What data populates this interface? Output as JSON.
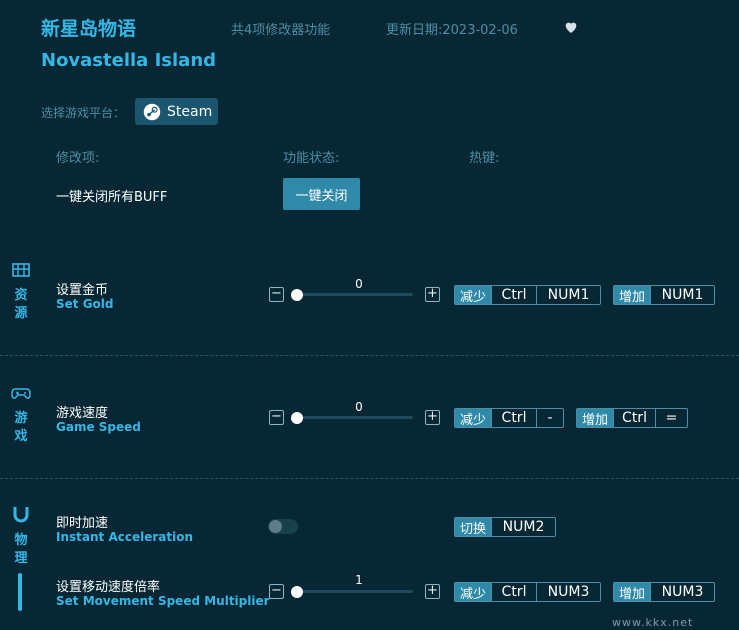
{
  "header": {
    "title_cn": "新星岛物语",
    "title_en": "Novastella Island",
    "feature_count": "共4项修改器功能",
    "update_date": "更新日期:2023-02-06",
    "favorite_icon": "heart-icon"
  },
  "platform": {
    "label": "选择游戏平台：",
    "button": "Steam",
    "icon": "steam-icon"
  },
  "columns": {
    "item": "修改项:",
    "status": "功能状态:",
    "hotkey": "热键:"
  },
  "close_all": {
    "label": "一键关闭所有BUFF",
    "button": "一键关闭"
  },
  "sections": {
    "resources": {
      "label": [
        "资",
        "源"
      ],
      "icon": "chest-icon"
    },
    "game": {
      "label": [
        "游",
        "戏"
      ],
      "icon": "gamepad-icon"
    },
    "physics": {
      "label": [
        "物",
        "理"
      ],
      "icon": "magnet-icon"
    }
  },
  "rows": {
    "set_gold": {
      "cn": "设置金币",
      "en": "Set Gold",
      "value": "0",
      "dec_keys": [
        "减少",
        "Ctrl",
        "NUM1"
      ],
      "inc_keys": [
        "增加",
        "NUM1"
      ]
    },
    "game_speed": {
      "cn": "游戏速度",
      "en": "Game Speed",
      "value": "0",
      "dec_keys": [
        "减少",
        "Ctrl",
        "-"
      ],
      "inc_keys": [
        "增加",
        "Ctrl",
        "="
      ]
    },
    "instant_accel": {
      "cn": "即时加速",
      "en": "Instant Acceleration",
      "enabled": false,
      "toggle_keys": [
        "切换",
        "NUM2"
      ]
    },
    "move_speed": {
      "cn": "设置移动速度倍率",
      "en": "Set Movement Speed Multiplier",
      "value": "1",
      "dec_keys": [
        "减少",
        "Ctrl",
        "NUM3"
      ],
      "inc_keys": [
        "增加",
        "NUM3"
      ]
    }
  },
  "watermark": "www.kkx.net",
  "colors": {
    "background": "#062733",
    "accent": "#35b7e6",
    "button": "#2e8aa8"
  }
}
